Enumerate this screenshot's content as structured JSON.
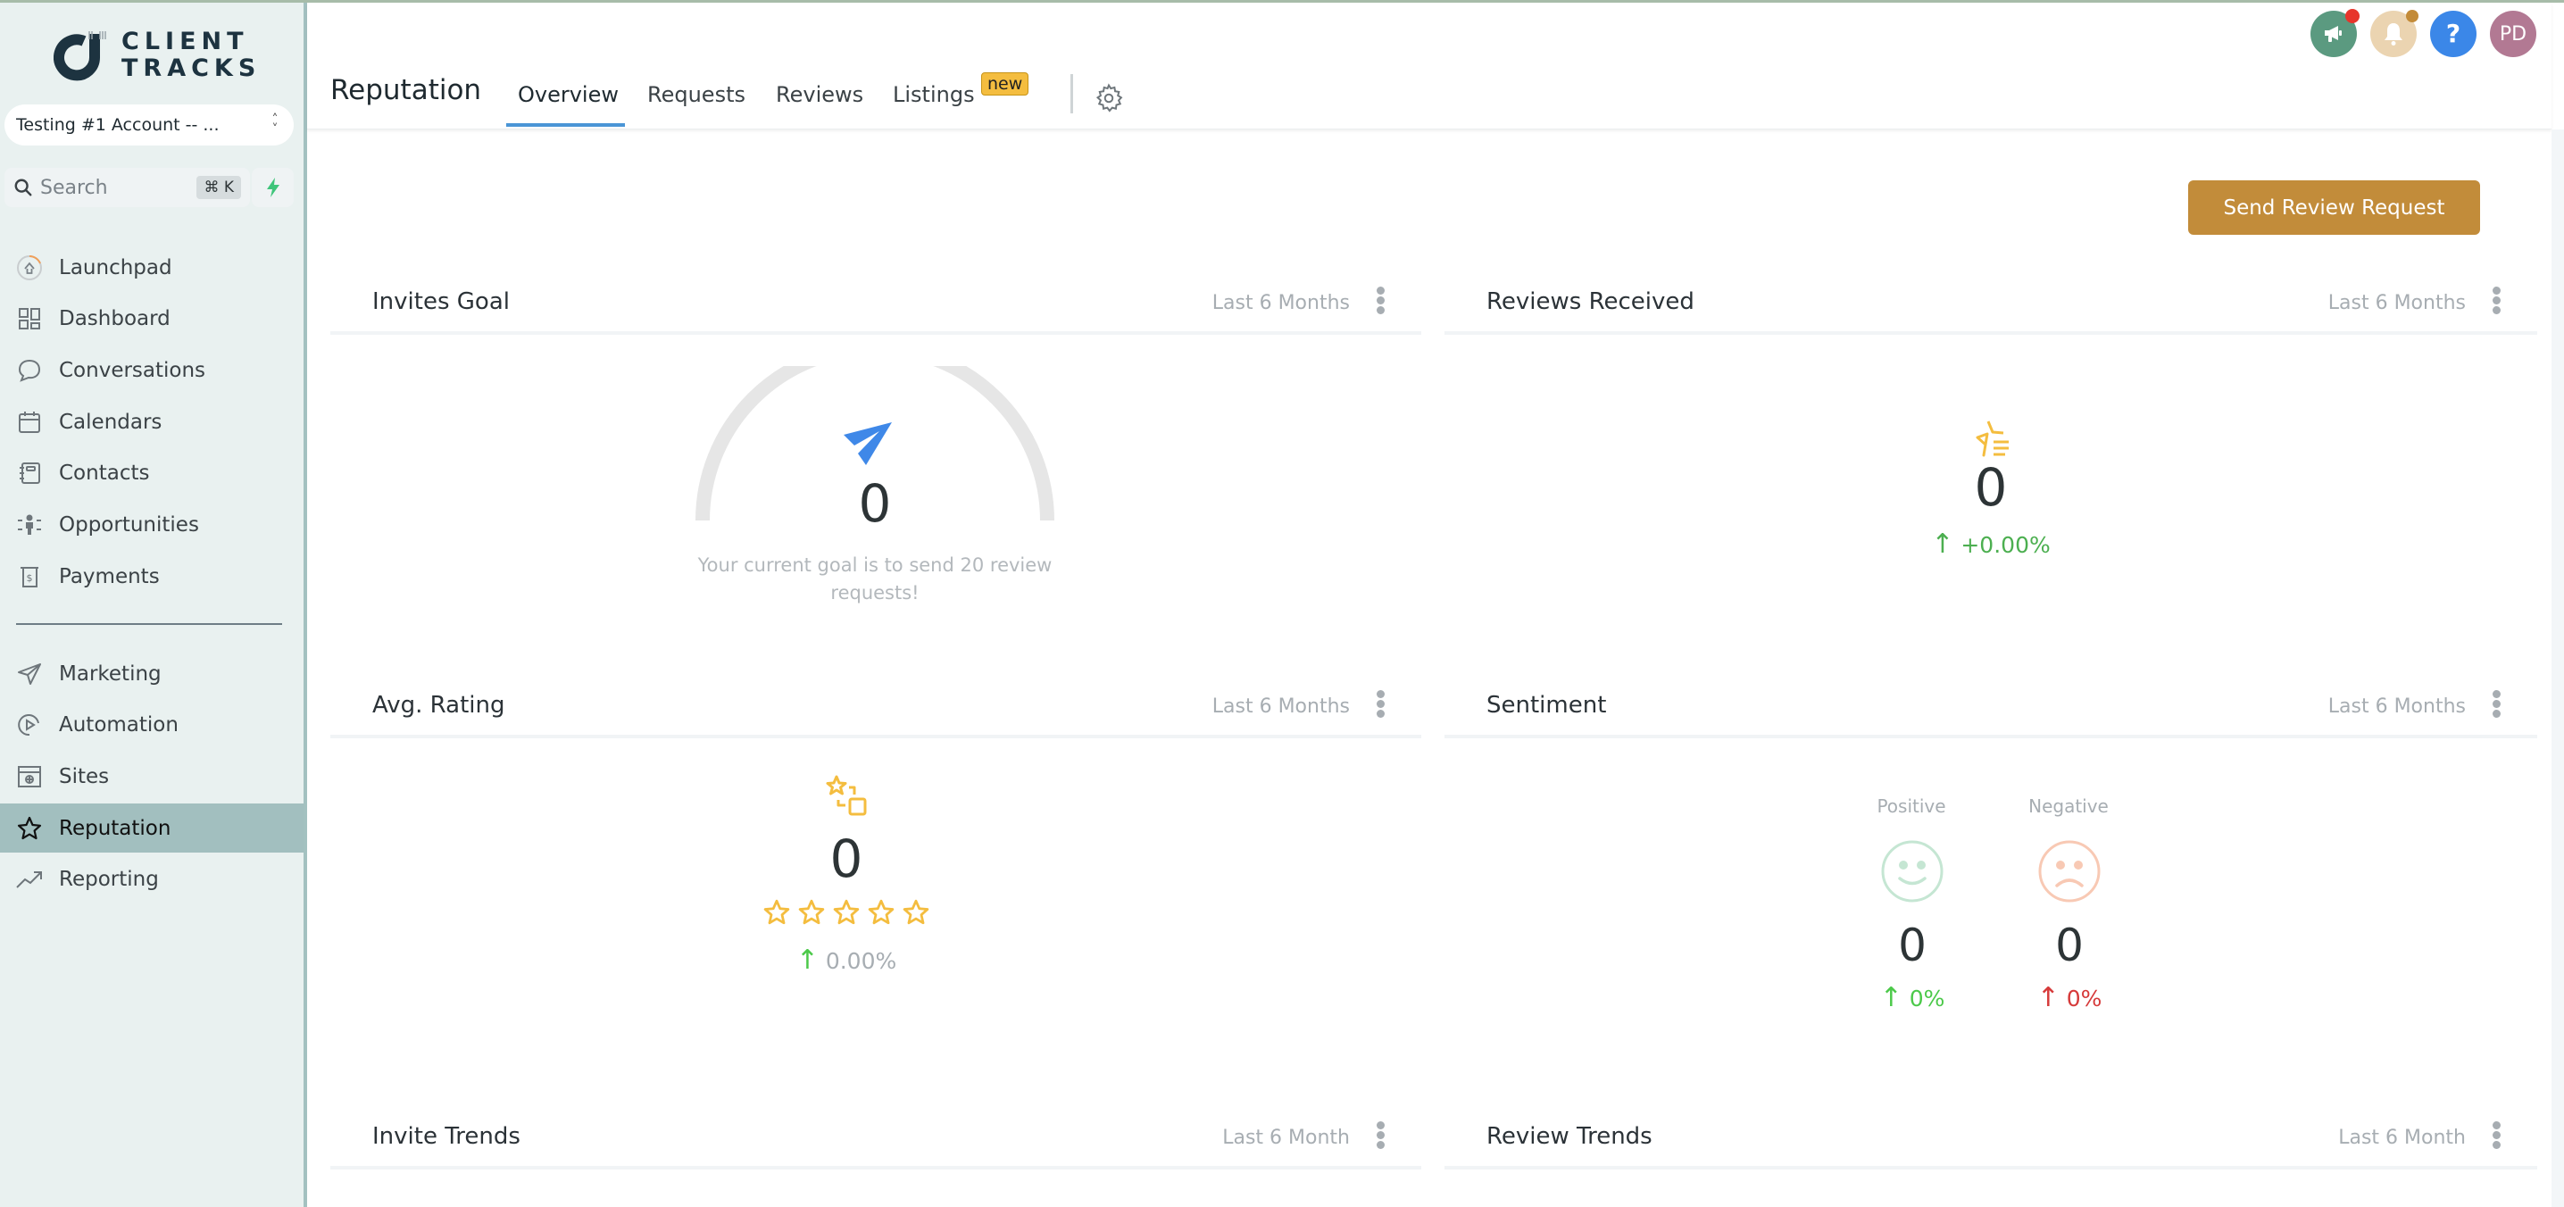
{
  "brand": {
    "line1": "CLIENT",
    "line2": "TRACKS"
  },
  "account": {
    "name": "Testing #1 Account -- ..."
  },
  "search": {
    "placeholder": "Search",
    "shortcut": "⌘ K"
  },
  "sidebar": {
    "items": [
      {
        "label": "Launchpad",
        "icon": "launchpad-icon"
      },
      {
        "label": "Dashboard",
        "icon": "dashboard-icon"
      },
      {
        "label": "Conversations",
        "icon": "chat-bubble-icon"
      },
      {
        "label": "Calendars",
        "icon": "calendar-icon"
      },
      {
        "label": "Contacts",
        "icon": "contacts-book-icon"
      },
      {
        "label": "Opportunities",
        "icon": "opportunities-icon"
      },
      {
        "label": "Payments",
        "icon": "payments-icon"
      }
    ],
    "items2": [
      {
        "label": "Marketing",
        "icon": "send-icon"
      },
      {
        "label": "Automation",
        "icon": "automation-icon"
      },
      {
        "label": "Sites",
        "icon": "sites-icon"
      },
      {
        "label": "Reputation",
        "icon": "star-icon",
        "active": true
      },
      {
        "label": "Reporting",
        "icon": "trend-icon"
      }
    ]
  },
  "header": {
    "title": "Reputation",
    "tabs": [
      {
        "label": "Overview",
        "active": true
      },
      {
        "label": "Requests"
      },
      {
        "label": "Reviews"
      },
      {
        "label": "Listings",
        "badge": "new"
      }
    ],
    "avatar_initials": "PD"
  },
  "colors": {
    "accent": "#c28c3a",
    "primary_blue": "#4a95d6",
    "positive": "#4caf50",
    "negative": "#d63a3a",
    "star": "#f4bd3f"
  },
  "actions": {
    "send_review_request": "Send Review Request"
  },
  "cards": {
    "invites_goal": {
      "title": "Invites Goal",
      "range": "Last 6 Months",
      "value": "0",
      "goal_progress": 0,
      "goal_text": "Your current goal is to send 20 review requests!"
    },
    "reviews_received": {
      "title": "Reviews Received",
      "range": "Last 6 Months",
      "value": "0",
      "change": "+0.00%"
    },
    "avg_rating": {
      "title": "Avg. Rating",
      "range": "Last 6 Months",
      "value": "0",
      "stars_filled": 0,
      "stars_total": 5,
      "change": "0.00%"
    },
    "sentiment": {
      "title": "Sentiment",
      "range": "Last 6 Months",
      "positive": {
        "label": "Positive",
        "value": "0",
        "change": "0%"
      },
      "negative": {
        "label": "Negative",
        "value": "0",
        "change": "0%"
      }
    },
    "invite_trends": {
      "title": "Invite Trends",
      "range": "Last 6 Month"
    },
    "review_trends": {
      "title": "Review Trends",
      "range": "Last 6 Month"
    }
  }
}
